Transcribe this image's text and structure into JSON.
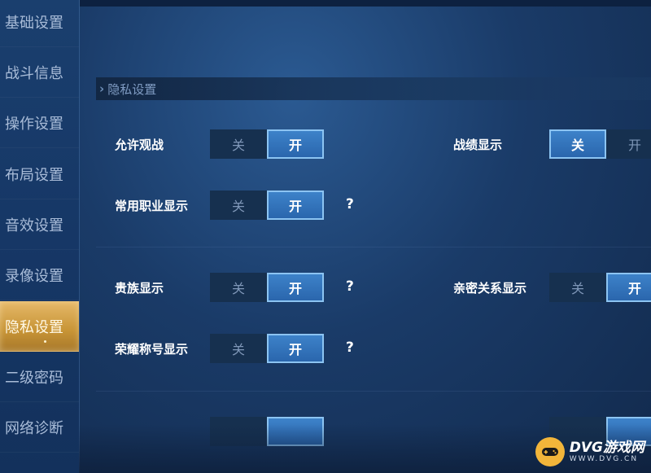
{
  "sidebar": {
    "items": [
      {
        "label": "基础设置",
        "active": false
      },
      {
        "label": "战斗信息",
        "active": false
      },
      {
        "label": "操作设置",
        "active": false
      },
      {
        "label": "布局设置",
        "active": false
      },
      {
        "label": "音效设置",
        "active": false
      },
      {
        "label": "录像设置",
        "active": false
      },
      {
        "label": "隐私设置",
        "active": true
      },
      {
        "label": "二级密码",
        "active": false
      },
      {
        "label": "网络诊断",
        "active": false
      }
    ]
  },
  "section": {
    "title": "隐私设置"
  },
  "toggle_labels": {
    "off": "关",
    "on": "开"
  },
  "help_symbol": "?",
  "settings": [
    {
      "label": "允许观战",
      "value": "开"
    },
    {
      "label": "战绩显示",
      "value": "关"
    },
    {
      "label": "常用职业显示",
      "value": "开",
      "help": true
    },
    {
      "label": "贵族显示",
      "value": "开",
      "help": true
    },
    {
      "label": "亲密关系显示",
      "value": "开"
    },
    {
      "label": "荣耀称号显示",
      "value": "开",
      "help": true
    }
  ],
  "colors": {
    "accent_selected": "#2f6fb5",
    "sidebar_active": "#d4a24c"
  },
  "watermark": {
    "brand": "DVG游戏网",
    "url": "WWW.DVG.CN",
    "icon": "gamepad-icon"
  }
}
